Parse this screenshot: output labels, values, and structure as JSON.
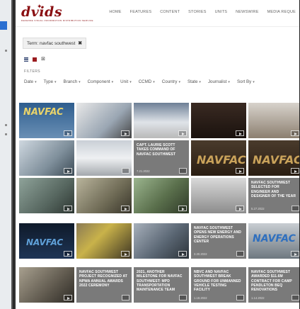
{
  "logo": {
    "word": "dvids",
    "tagline": "DEFENSE VISUAL INFORMATION DISTRIBUTION SERVICE"
  },
  "nav": [
    "HOME",
    "FEATURES",
    "CONTENT",
    "STORIES",
    "UNITS",
    "NEWSWIRE",
    "MEDIA REQUE"
  ],
  "term": {
    "label": "Term: navfac southwest",
    "close": "✖"
  },
  "view_toggles": {
    "rss": "⊠"
  },
  "filters_label": "FILTERS",
  "filters": [
    "Date",
    "Type",
    "Branch",
    "Component",
    "Unit",
    "CCMD",
    "Country",
    "State",
    "Journalist",
    "Sort By"
  ],
  "filter_caret": "▾",
  "tiles": [
    {
      "title": "",
      "date": ""
    },
    {
      "title": "",
      "date": ""
    },
    {
      "title": "",
      "date": ""
    },
    {
      "title": "",
      "date": ""
    },
    {
      "title": "",
      "date": ""
    },
    {
      "title": "",
      "date": ""
    },
    {
      "title": "",
      "date": ""
    },
    {
      "title": "CAPT. LAURIE SCOTT TAKES COMMAND OF NAVFAC SOUTHWEST",
      "date": "7.21.2022"
    },
    {
      "title": "",
      "date": ""
    },
    {
      "title": "",
      "date": ""
    },
    {
      "title": "",
      "date": ""
    },
    {
      "title": "",
      "date": ""
    },
    {
      "title": "",
      "date": ""
    },
    {
      "title": "",
      "date": ""
    },
    {
      "title": "NAVFAC SOUTHWEST SELECTED FOR ENGINEER AND DESIGNER OF THE YEAR",
      "date": "5.27.2022"
    },
    {
      "title": "",
      "date": ""
    },
    {
      "title": "",
      "date": ""
    },
    {
      "title": "",
      "date": ""
    },
    {
      "title": "NAVFAC SOUTHWEST OPENS NEW ENERGY AND ENERGY OPERATIONS CENTER",
      "date": "3.30.2022"
    },
    {
      "title": "",
      "date": ""
    },
    {
      "title": "NAVFAC SOUTHWEST PROJECT RECOGNIZED AT NPWA ANNUAL AWARDS 2022 CEREMONY",
      "date": ""
    },
    {
      "title": "2021, ANOTHER MILESTONE FOR NAVFAC SOUTHWEST: MPD TRANSPORTATION MAINTENANCE TEAM",
      "date": ""
    },
    {
      "title": "",
      "date": ""
    },
    {
      "title": "NBVC AND NAVFAC SOUTHWEST BREAK GROUND FOR UNMANNED VEHICLE TESTING FACILITY",
      "date": "1.18.2022"
    },
    {
      "title": "NAVFAC SOUTHWEST AWARDED $11.6M CONTRACT FOR CAMP PENDLETON BEQ RENOVATIONS",
      "date": "1.14.2022"
    }
  ],
  "navfac_text": "NAVFAC",
  "colors": {
    "brand": "#8a0f12",
    "tile_gray": "#777777",
    "accent_blue": "#2a6fd1"
  }
}
